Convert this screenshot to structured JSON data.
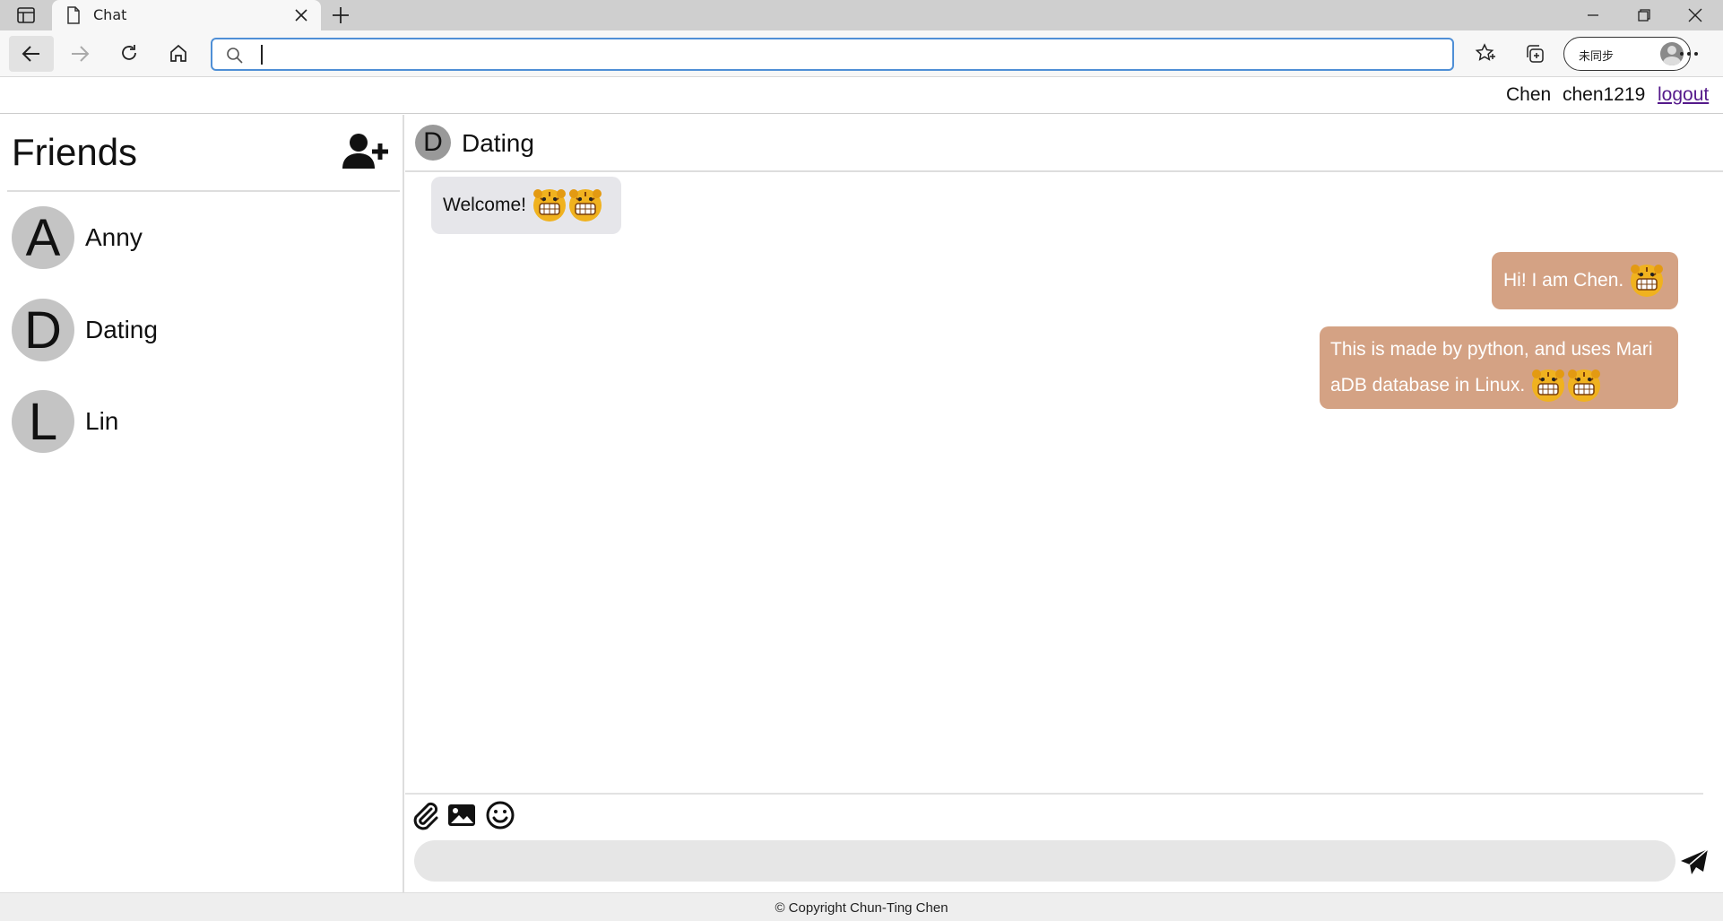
{
  "browser": {
    "tab_title": "Chat",
    "url_value": "",
    "sync_label": "未同步"
  },
  "user": {
    "name": "Chen",
    "username": "chen1219",
    "logout_label": "logout"
  },
  "sidebar": {
    "title": "Friends",
    "friends": [
      {
        "initial": "A",
        "name": "Anny"
      },
      {
        "initial": "D",
        "name": "Dating"
      },
      {
        "initial": "L",
        "name": "Lin"
      }
    ]
  },
  "chat": {
    "initial": "D",
    "name": "Dating",
    "messages": [
      {
        "direction": "in",
        "text": "Welcome!",
        "emoji_count": 2
      },
      {
        "direction": "out",
        "text": "Hi!  I am Chen.",
        "emoji_count": 1
      },
      {
        "direction": "out",
        "text_line1": "This is made by python, and uses Mari",
        "text_line2": "aDB database in Linux.",
        "emoji_count": 2
      }
    ],
    "input_value": ""
  },
  "colors": {
    "incoming_bubble": "#e6e6ea",
    "outgoing_bubble": "#d4a284",
    "avatar_gray": "#c4c4c4",
    "link": "#551a8b"
  },
  "icons": [
    "sidebar-toggle-icon",
    "page-icon",
    "close-icon",
    "new-tab-icon",
    "back-icon",
    "forward-icon",
    "reload-icon",
    "home-icon",
    "search-icon",
    "favorites-star-icon",
    "collections-icon",
    "more-icon",
    "add-friend-icon",
    "attach-icon",
    "image-icon",
    "emoji-icon",
    "send-icon"
  ],
  "footer": {
    "copyright": "© Copyright Chun-Ting Chen"
  }
}
